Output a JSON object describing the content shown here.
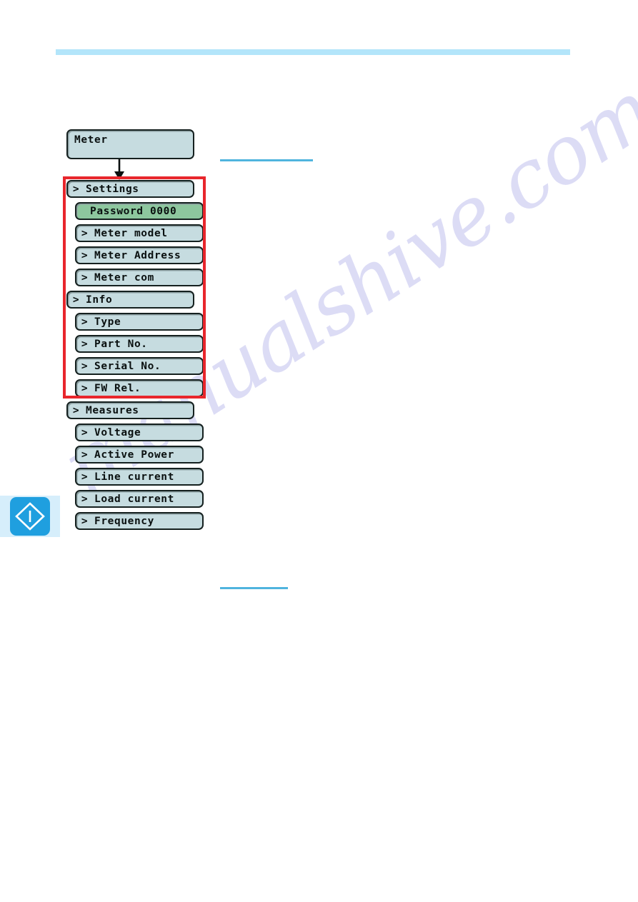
{
  "page": {
    "header_rule_color": "#b3e5fa",
    "caption_rule_color": "#4fb4de",
    "watermark_text": "manualshive.com"
  },
  "note_badge": {
    "icon": "important-diamond-icon",
    "accent_color": "#1f9fdf"
  },
  "highlight_frame": {
    "color": "#e8262c",
    "covers": [
      "Settings",
      "Password 0000",
      "Meter model",
      "Meter Address",
      "Meter com",
      "Info",
      "Type",
      "Part No.",
      "Serial No.",
      "FW Rel."
    ]
  },
  "menu_tree": {
    "root": {
      "label": "Meter"
    },
    "nodes": [
      {
        "id": "settings",
        "label": "Settings",
        "chevron": ">",
        "level": 1,
        "highlighted": false
      },
      {
        "id": "password",
        "label": "Password 0000",
        "chevron": "",
        "level": 2,
        "highlighted": true
      },
      {
        "id": "meter-model",
        "label": "Meter model",
        "chevron": ">",
        "level": 2,
        "highlighted": false
      },
      {
        "id": "meter-address",
        "label": "Meter Address",
        "chevron": ">",
        "level": 2,
        "highlighted": false
      },
      {
        "id": "meter-com",
        "label": "Meter com",
        "chevron": ">",
        "level": 2,
        "highlighted": false
      },
      {
        "id": "info",
        "label": "Info",
        "chevron": ">",
        "level": 1,
        "highlighted": false
      },
      {
        "id": "type",
        "label": "Type",
        "chevron": ">",
        "level": 2,
        "highlighted": false
      },
      {
        "id": "part-no",
        "label": "Part No.",
        "chevron": ">",
        "level": 2,
        "highlighted": false
      },
      {
        "id": "serial-no",
        "label": "Serial No.",
        "chevron": ">",
        "level": 2,
        "highlighted": false
      },
      {
        "id": "fw-rel",
        "label": "FW Rel.",
        "chevron": ">",
        "level": 2,
        "highlighted": false
      },
      {
        "id": "measures",
        "label": "Measures",
        "chevron": ">",
        "level": 1,
        "highlighted": false
      },
      {
        "id": "voltage",
        "label": "Voltage",
        "chevron": ">",
        "level": 2,
        "highlighted": false
      },
      {
        "id": "active-power",
        "label": "Active Power",
        "chevron": ">",
        "level": 2,
        "highlighted": false
      },
      {
        "id": "line-current",
        "label": "Line current",
        "chevron": ">",
        "level": 2,
        "highlighted": false
      },
      {
        "id": "load-current",
        "label": "Load current",
        "chevron": ">",
        "level": 2,
        "highlighted": false
      },
      {
        "id": "frequency",
        "label": "Frequency",
        "chevron": ">",
        "level": 2,
        "highlighted": false
      }
    ]
  }
}
